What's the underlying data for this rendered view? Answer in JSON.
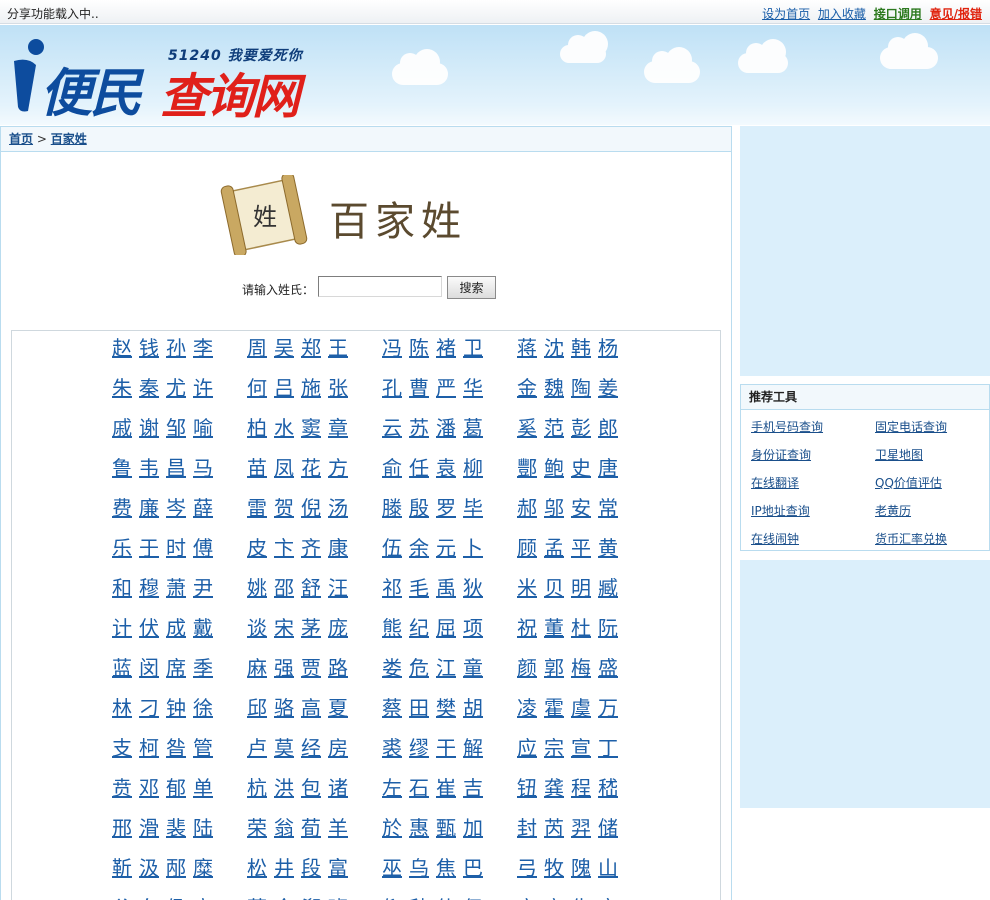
{
  "topbar": {
    "share_status": "分享功能载入中..",
    "links": [
      "设为首页",
      "加入收藏",
      "接口调用",
      "意见/报错"
    ]
  },
  "logo": {
    "name_part1": "便民",
    "name_part2": "查询网",
    "slogan": "51240 我要爱死你"
  },
  "breadcrumb": {
    "home": "首页",
    "separator": ">",
    "current": "百家姓"
  },
  "banner": {
    "title": "百家姓",
    "scroll_char": "姓"
  },
  "search": {
    "label": "请输入姓氏：",
    "input_value": "",
    "button": "搜索"
  },
  "surnames": [
    [
      [
        "赵",
        "钱",
        "孙",
        "李"
      ],
      [
        "周",
        "吴",
        "郑",
        "王"
      ],
      [
        "冯",
        "陈",
        "褚",
        "卫"
      ],
      [
        "蒋",
        "沈",
        "韩",
        "杨"
      ]
    ],
    [
      [
        "朱",
        "秦",
        "尤",
        "许"
      ],
      [
        "何",
        "吕",
        "施",
        "张"
      ],
      [
        "孔",
        "曹",
        "严",
        "华"
      ],
      [
        "金",
        "魏",
        "陶",
        "姜"
      ]
    ],
    [
      [
        "戚",
        "谢",
        "邹",
        "喻"
      ],
      [
        "柏",
        "水",
        "窦",
        "章"
      ],
      [
        "云",
        "苏",
        "潘",
        "葛"
      ],
      [
        "奚",
        "范",
        "彭",
        "郎"
      ]
    ],
    [
      [
        "鲁",
        "韦",
        "昌",
        "马"
      ],
      [
        "苗",
        "凤",
        "花",
        "方"
      ],
      [
        "俞",
        "任",
        "袁",
        "柳"
      ],
      [
        "酆",
        "鲍",
        "史",
        "唐"
      ]
    ],
    [
      [
        "费",
        "廉",
        "岑",
        "薛"
      ],
      [
        "雷",
        "贺",
        "倪",
        "汤"
      ],
      [
        "滕",
        "殷",
        "罗",
        "毕"
      ],
      [
        "郝",
        "邬",
        "安",
        "常"
      ]
    ],
    [
      [
        "乐",
        "于",
        "时",
        "傅"
      ],
      [
        "皮",
        "卞",
        "齐",
        "康"
      ],
      [
        "伍",
        "余",
        "元",
        "卜"
      ],
      [
        "顾",
        "孟",
        "平",
        "黄"
      ]
    ],
    [
      [
        "和",
        "穆",
        "萧",
        "尹"
      ],
      [
        "姚",
        "邵",
        "舒",
        "汪"
      ],
      [
        "祁",
        "毛",
        "禹",
        "狄"
      ],
      [
        "米",
        "贝",
        "明",
        "臧"
      ]
    ],
    [
      [
        "计",
        "伏",
        "成",
        "戴"
      ],
      [
        "谈",
        "宋",
        "茅",
        "庞"
      ],
      [
        "熊",
        "纪",
        "屈",
        "项"
      ],
      [
        "祝",
        "董",
        "杜",
        "阮"
      ]
    ],
    [
      [
        "蓝",
        "闵",
        "席",
        "季"
      ],
      [
        "麻",
        "强",
        "贾",
        "路"
      ],
      [
        "娄",
        "危",
        "江",
        "童"
      ],
      [
        "颜",
        "郭",
        "梅",
        "盛"
      ]
    ],
    [
      [
        "林",
        "刁",
        "钟",
        "徐"
      ],
      [
        "邱",
        "骆",
        "高",
        "夏"
      ],
      [
        "蔡",
        "田",
        "樊",
        "胡"
      ],
      [
        "凌",
        "霍",
        "虞",
        "万"
      ]
    ],
    [
      [
        "支",
        "柯",
        "昝",
        "管"
      ],
      [
        "卢",
        "莫",
        "经",
        "房"
      ],
      [
        "裘",
        "缪",
        "干",
        "解"
      ],
      [
        "应",
        "宗",
        "宣",
        "丁"
      ]
    ],
    [
      [
        "贲",
        "邓",
        "郁",
        "单"
      ],
      [
        "杭",
        "洪",
        "包",
        "诸"
      ],
      [
        "左",
        "石",
        "崔",
        "吉"
      ],
      [
        "钮",
        "龚",
        "程",
        "嵇"
      ]
    ],
    [
      [
        "邢",
        "滑",
        "裴",
        "陆"
      ],
      [
        "荣",
        "翁",
        "荀",
        "羊"
      ],
      [
        "於",
        "惠",
        "甄",
        "加"
      ],
      [
        "封",
        "芮",
        "羿",
        "储"
      ]
    ],
    [
      [
        "靳",
        "汲",
        "邴",
        "糜"
      ],
      [
        "松",
        "井",
        "段",
        "富"
      ],
      [
        "巫",
        "乌",
        "焦",
        "巴"
      ],
      [
        "弓",
        "牧",
        "隗",
        "山"
      ]
    ],
    [
      [
        "谷",
        "车",
        "侯",
        "宓"
      ],
      [
        "蓬",
        "全",
        "郗",
        "班"
      ],
      [
        "仰",
        "秋",
        "仲",
        "伊"
      ],
      [
        "宫",
        "宁",
        "仇",
        "栾"
      ]
    ]
  ],
  "tools": {
    "title": "推荐工具",
    "items": [
      "手机号码查询",
      "固定电话查询",
      "身份证查询",
      "卫星地图",
      "在线翻译",
      "QQ价值评估",
      "IP地址查询",
      "老黄历",
      "在线闹钟",
      "货币汇率兑换"
    ]
  },
  "colors": {
    "link": "#1d5fa8",
    "api_link": "#2d7a1f",
    "report_link": "#e0230e",
    "border": "#b9dcef",
    "sky": "#bfe1f6"
  }
}
